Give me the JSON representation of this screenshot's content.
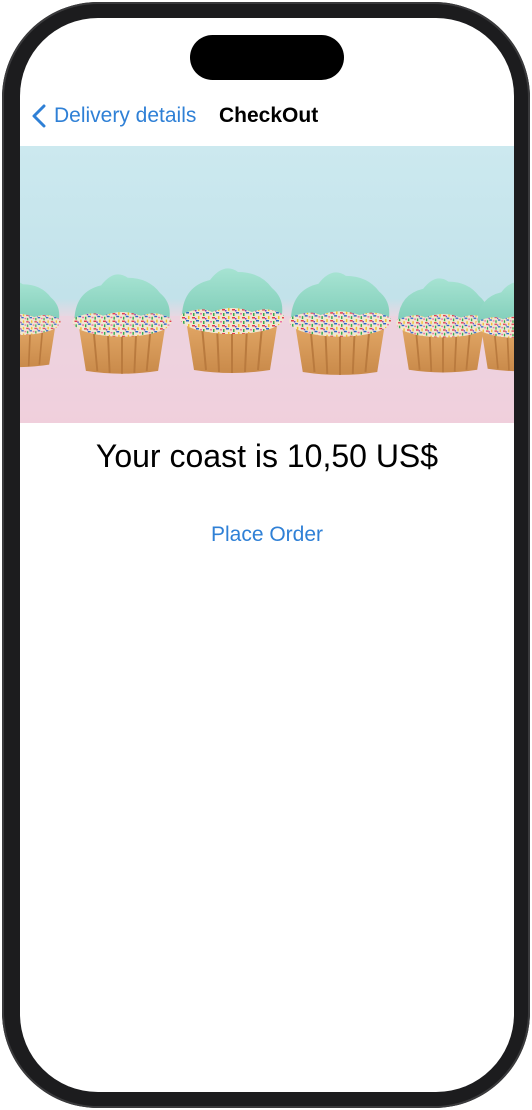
{
  "nav": {
    "back_label": "Delivery details",
    "title": "CheckOut"
  },
  "hero": {
    "image": "cupcakes-photo",
    "alt": "cupcakes with mint frosting and rainbow sprinkles"
  },
  "main": {
    "cost_text": "Your coast is 10,50 US$",
    "place_order_label": "Place Order"
  },
  "icons": {
    "back": "chevron-left-icon"
  },
  "colors": {
    "accent": "#2f80d6",
    "frame": "#1c1c1e",
    "background": "#ffffff",
    "frosting": "#8fd6c2",
    "sky": "#bfe3ea"
  }
}
